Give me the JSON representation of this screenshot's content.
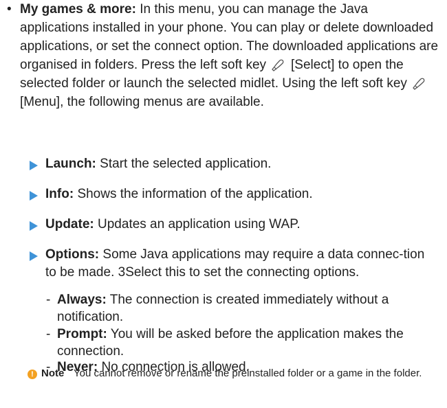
{
  "intro": {
    "bullet": "•",
    "title": "My games & more:",
    "text1": "In this menu, you can manage the Java applications installed in your phone. You can play or delete downloaded applications, or set the connect option. The downloaded applications are organised in folders. Press the left soft key",
    "text2": "[Select] to open the selected folder or launch the selected midlet. Using the left soft key",
    "text3": "[Menu], the following menus are available."
  },
  "items": [
    {
      "title": "Launch:",
      "text": "Start the selected application."
    },
    {
      "title": "Info:",
      "text": "Shows the information of the application."
    },
    {
      "title": "Update:",
      "text": "Updates an application using WAP."
    },
    {
      "title": "Options:",
      "text": "Some Java applications may require a data connec-tion to be made. 3Select this to set the connecting options."
    }
  ],
  "subitems": [
    {
      "dash": "-",
      "title": "Always:",
      "text": "The connection is created immediately without a notification."
    },
    {
      "dash": "-",
      "title": "Prompt:",
      "text": "You will be asked before the application makes the connection."
    },
    {
      "dash": "-",
      "title": "Never:",
      "text": "No connection is allowed."
    }
  ],
  "note": {
    "icon": "!",
    "label": "Note",
    "text": "You cannot remove or rename the preinstalled folder or a game in the folder."
  },
  "icons": {
    "soft_key": "soft-key-icon",
    "item_marker": "triangle-bullet-icon",
    "note": "info-icon"
  },
  "colors": {
    "accent": "#3f93d8",
    "note_icon": "#f3a122"
  }
}
